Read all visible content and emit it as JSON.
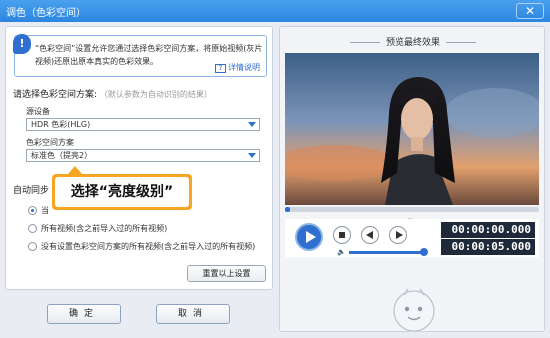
{
  "window": {
    "title": "调色（色彩空间）",
    "close_label": "✕"
  },
  "info": {
    "icon": "!",
    "text": "“色彩空间”设置允许您通过选择色彩空间方案，将原始视频(灰片视频)还原出原本真实的色彩效果。",
    "detail_link": "详情说明"
  },
  "color_space": {
    "heading": "请选择色彩空间方案:",
    "hint": "（默认参数为自动识别的结果）",
    "source_device_label": "源设备",
    "source_device_value": "HDR 色彩(HLG)",
    "scheme_label": "色彩空间方案",
    "scheme_value": "标准色（提亮2）"
  },
  "apply": {
    "heading_partial": "自动同步",
    "options": [
      {
        "label": "当",
        "selected": true
      },
      {
        "label": "所有视频(含之前导入过的所有视频)",
        "selected": false
      },
      {
        "label": "没有设置色彩空间方案的所有视频(含之前导入过的所有视频)",
        "selected": false
      }
    ],
    "reset_button": "重置以上设置"
  },
  "callout": {
    "text": "选择“亮度级别”"
  },
  "buttons": {
    "ok": "确定",
    "cancel": "取消"
  },
  "preview": {
    "title": "预览最终效果",
    "progress": 0.02,
    "current_time": "00:00:00.000",
    "total_time": "00:00:05.000",
    "volume": 1.0
  }
}
